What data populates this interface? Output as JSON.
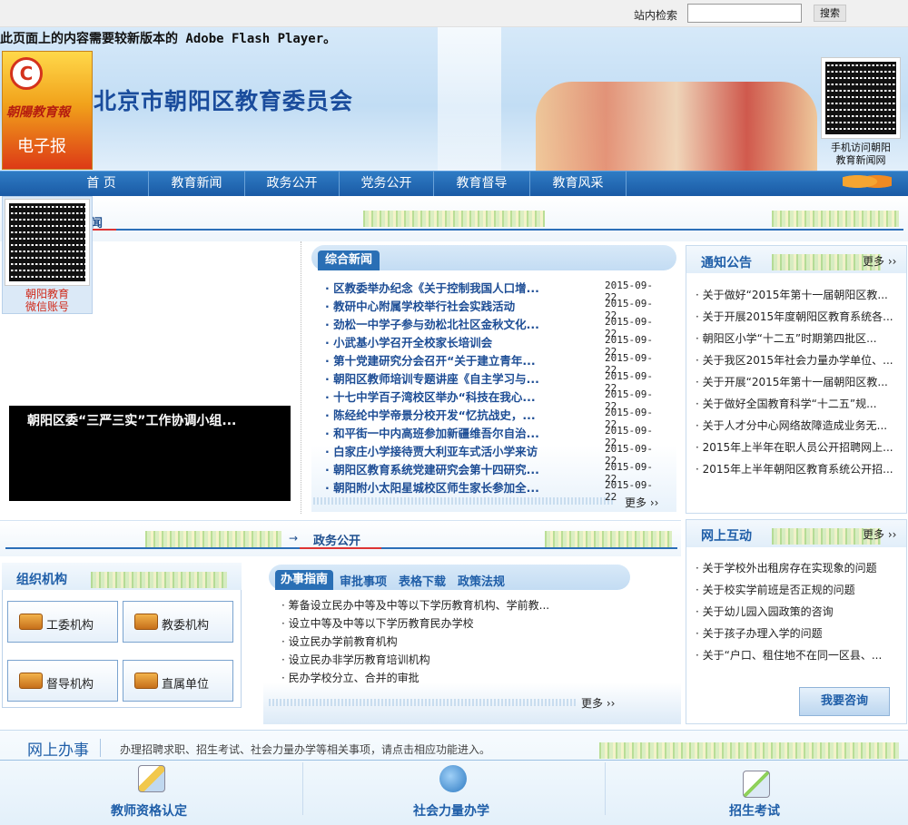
{
  "search": {
    "label": "站内检索",
    "button": "搜索",
    "value": ""
  },
  "banner": {
    "flash_notice": "此页面上的内容需要较新版本的 Adobe Flash Player。",
    "site_title": "北京市朝阳区教育委员会",
    "epaper": {
      "name": "朝陽教育報",
      "label": "电子报"
    },
    "qr_caption_line1": "手机访问朝阳",
    "qr_caption_line2": "教育新闻网"
  },
  "nav": [
    "首 页",
    "教育新闻",
    "政务公开",
    "党务公开",
    "教育督导",
    "教育风采"
  ],
  "section1_title": "闻",
  "float_qr": {
    "line1": "朝阳教育",
    "line2": "微信账号"
  },
  "slideshow": {
    "caption": "朝阳区委“三严三实”工作协调小组..."
  },
  "news": {
    "tab": "综合新闻",
    "more": "更多",
    "items": [
      {
        "title": "区教委举办纪念《关于控制我国人口增...",
        "date": "2015-09-22"
      },
      {
        "title": "教研中心附属学校举行社会实践活动",
        "date": "2015-09-22"
      },
      {
        "title": "劲松一中学子参与劲松北社区金秋文化...",
        "date": "2015-09-22"
      },
      {
        "title": "小武基小学召开全校家长培训会",
        "date": "2015-09-22"
      },
      {
        "title": "第十党建研究分会召开“关于建立青年...",
        "date": "2015-09-22"
      },
      {
        "title": "朝阳区教师培训专题讲座《自主学习与...",
        "date": "2015-09-22"
      },
      {
        "title": "十七中学百子湾校区举办“科技在我心...",
        "date": "2015-09-22"
      },
      {
        "title": "陈经纶中学帝景分校开发“忆抗战史，...",
        "date": "2015-09-22"
      },
      {
        "title": "和平街一中内高班参加新疆维吾尔自治...",
        "date": "2015-09-22"
      },
      {
        "title": "白家庄小学接待贾大利亚车式活小学来访",
        "date": "2015-09-22"
      },
      {
        "title": "朝阳区教育系统党建研究会第十四研究...",
        "date": "2015-09-22"
      },
      {
        "title": "朝阳附小太阳星城校区师生家长参加全...",
        "date": "2015-09-22"
      }
    ]
  },
  "notice": {
    "title": "通知公告",
    "more": "更多",
    "items": [
      "关于做好“2015年第十一届朝阳区教...",
      "关于开展2015年度朝阳区教育系统各...",
      "朝阳区小学“十二五”时期第四批区...",
      "关于我区2015年社会力量办学单位、...",
      "关于开展“2015年第十一届朝阳区教...",
      "关于做好全国教育科学“十二五”规...",
      "关于人才分中心网络故障造成业务无...",
      "2015年上半年在职人员公开招聘网上...",
      "2015年上半年朝阳区教育系统公开招..."
    ]
  },
  "gov": {
    "title": "政务公开",
    "arrow": "→"
  },
  "org": {
    "title": "组织机构",
    "buttons": [
      "工委机构",
      "教委机构",
      "督导机构",
      "直属单位"
    ]
  },
  "guide": {
    "tabs": [
      "办事指南",
      "审批事项",
      "表格下载",
      "政策法规"
    ],
    "more": "更多",
    "items": [
      "筹备设立民办中等及中等以下学历教育机构、学前教...",
      "设立中等及中等以下学历教育民办学校",
      "设立民办学前教育机构",
      "设立民办非学历教育培训机构",
      "民办学校分立、合并的审批"
    ]
  },
  "interact": {
    "title": "网上互动",
    "more": "更多",
    "ask": "我要咨询",
    "items": [
      "关于学校外出租房存在实现象的问题",
      "关于校实学前班是否正规的问题",
      "关于幼儿园入园政策的咨询",
      "关于孩子办理入学的问题",
      "关于“户口、租住地不在同一区县、..."
    ]
  },
  "online": {
    "title": "网上办事",
    "desc": "办理招聘求职、招生考试、社会力量办学等相关事项，请点击相应功能进入。",
    "services": [
      "教师资格认定",
      "社会力量办学",
      "招生考试"
    ]
  }
}
